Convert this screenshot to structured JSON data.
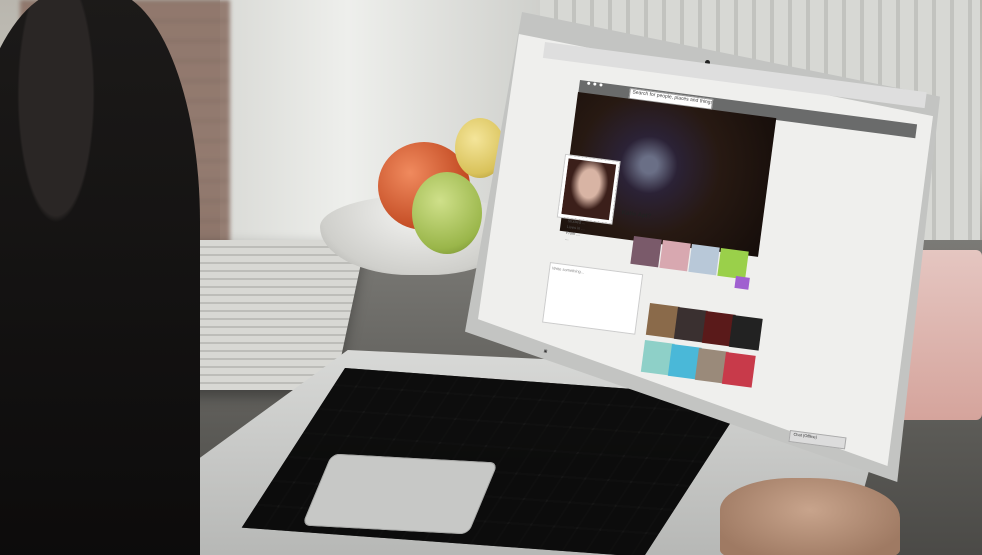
{
  "scene": {
    "description_colors": {
      "app_bar": "#6a6b6b",
      "screen_bg": "#efefed"
    }
  },
  "browser": {
    "search_placeholder": "Search for people, places and things"
  },
  "profile": {
    "name": "Katie Apt?",
    "info_lines": [
      "Studied ...",
      "Lives in ...",
      "From ...",
      "..."
    ],
    "composer_placeholder": "Write something..."
  },
  "bottom_bar": {
    "label": "Chat (Offline)"
  }
}
